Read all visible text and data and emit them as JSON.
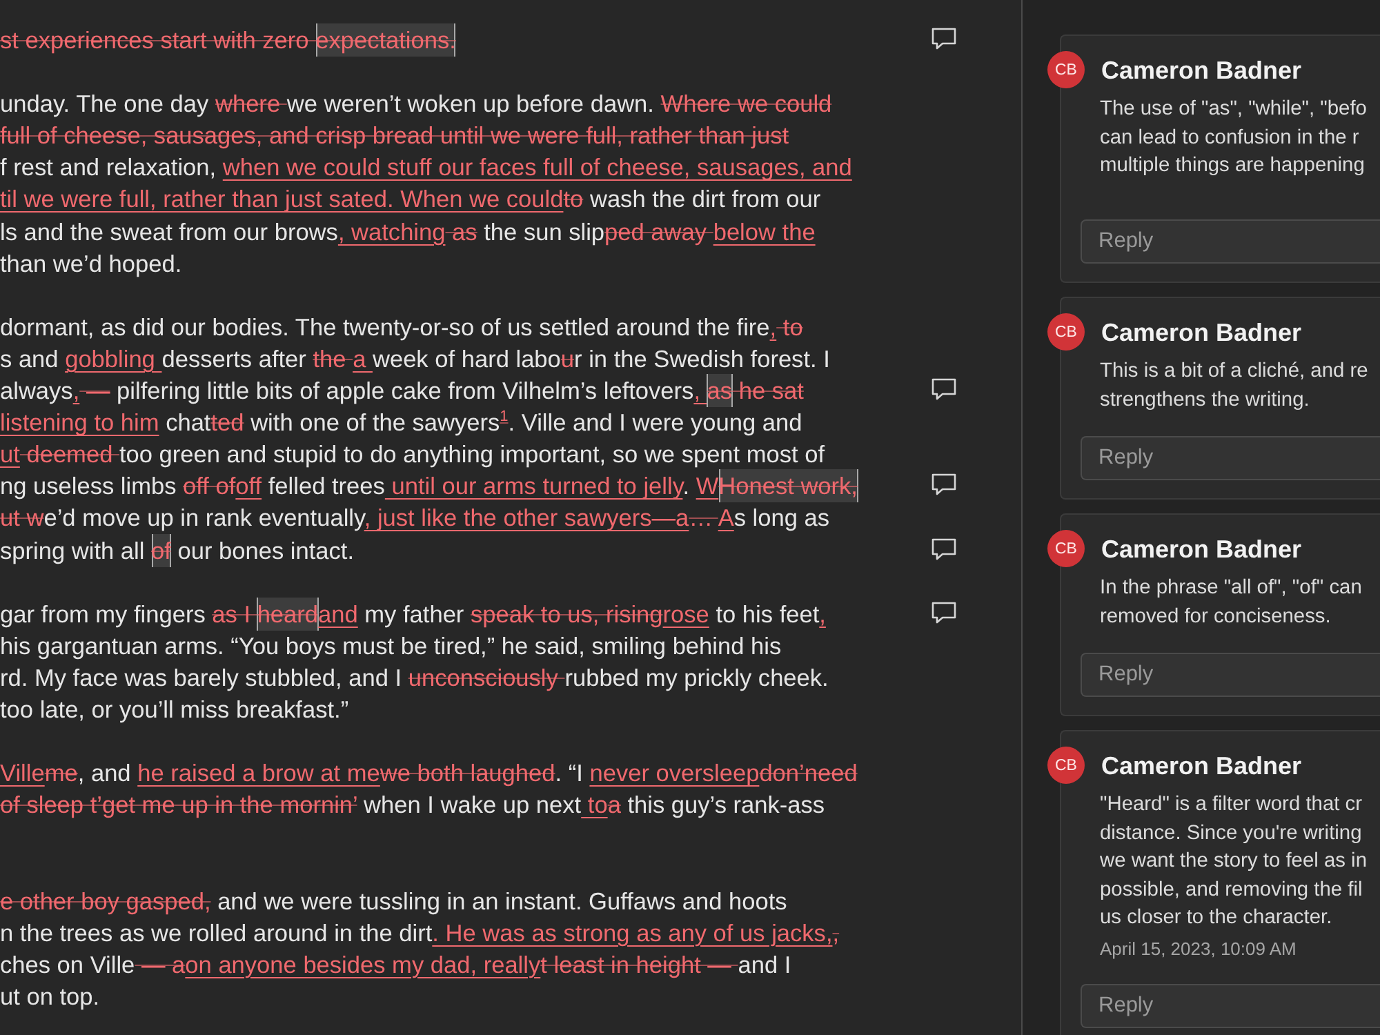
{
  "document": {
    "lines": [
      {
        "kind": "text",
        "comment": true,
        "parts": [
          {
            "kind": "deleted",
            "text": "st experiences start with zero "
          },
          {
            "kind": "anchored",
            "text": "expectations."
          }
        ]
      },
      {
        "kind": "blank",
        "comment": false
      },
      {
        "kind": "text",
        "comment": false,
        "parts": [
          {
            "kind": "text",
            "text": "unday. The one day "
          },
          {
            "kind": "deleted",
            "text": "where "
          },
          {
            "kind": "text",
            "text": "we weren’t woken up before dawn. "
          },
          {
            "kind": "deleted",
            "text": "Where we could"
          }
        ]
      },
      {
        "kind": "text",
        "comment": false,
        "parts": [
          {
            "kind": "deleted",
            "text": "full of cheese, sausages, and crisp bread until we were full, rather than just"
          }
        ]
      },
      {
        "kind": "text",
        "comment": false,
        "parts": [
          {
            "kind": "text",
            "text": "f rest and relaxation, "
          },
          {
            "kind": "inserted",
            "text": "when we could stuff our faces full of cheese, sausages, and"
          }
        ]
      },
      {
        "kind": "text",
        "comment": false,
        "parts": [
          {
            "kind": "inserted",
            "text": "til we were full, rather than just sated. When we could"
          },
          {
            "kind": "deleted",
            "text": "to"
          },
          {
            "kind": "text",
            "text": " wash the dirt from our"
          }
        ]
      },
      {
        "kind": "text",
        "comment": false,
        "parts": [
          {
            "kind": "text",
            "text": "ls and the sweat from our brows"
          },
          {
            "kind": "inserted",
            "text": ", watching"
          },
          {
            "kind": "deleted",
            "text": " as"
          },
          {
            "kind": "text",
            "text": " the sun slip"
          },
          {
            "kind": "deleted",
            "text": "ped away "
          },
          {
            "kind": "inserted",
            "text": "below the"
          }
        ]
      },
      {
        "kind": "text",
        "comment": false,
        "parts": [
          {
            "kind": "text",
            "text": "than we’d hoped."
          }
        ]
      },
      {
        "kind": "blank",
        "comment": false
      },
      {
        "kind": "text",
        "comment": false,
        "parts": [
          {
            "kind": "text",
            "text": "dormant, as did our bodies. The twenty-or-so of us settled around the fire"
          },
          {
            "kind": "inserted",
            "text": ","
          },
          {
            "kind": "deleted",
            "text": " to"
          }
        ]
      },
      {
        "kind": "text",
        "comment": false,
        "parts": [
          {
            "kind": "text",
            "text": "s and "
          },
          {
            "kind": "inserted",
            "text": "gobbling "
          },
          {
            "kind": "text",
            "text": "desserts after "
          },
          {
            "kind": "deleted",
            "text": "the "
          },
          {
            "kind": "inserted",
            "text": "a "
          },
          {
            "kind": "text",
            "text": "week of hard labo"
          },
          {
            "kind": "deleted",
            "text": "u"
          },
          {
            "kind": "text",
            "text": "r in the Swedish forest. I"
          }
        ]
      },
      {
        "kind": "text",
        "comment": true,
        "parts": [
          {
            "kind": "text",
            "text": "always"
          },
          {
            "kind": "inserted",
            "text": ","
          },
          {
            "kind": "deleted",
            "text": " —"
          },
          {
            "kind": "text",
            "text": " pilfering little bits of apple cake from Vilhelm’s leftovers"
          },
          {
            "kind": "inserted",
            "text": ", "
          },
          {
            "kind": "anchored",
            "text": "as"
          },
          {
            "kind": "deleted",
            "text": " he sat"
          }
        ]
      },
      {
        "kind": "text",
        "comment": false,
        "parts": [
          {
            "kind": "inserted",
            "text": "listening to him"
          },
          {
            "kind": "text",
            "text": " chat"
          },
          {
            "kind": "deleted",
            "text": "ted"
          },
          {
            "kind": "text",
            "text": " with one of the sawyers"
          },
          {
            "kind": "deleted",
            "text": "$^{1}$"
          },
          {
            "kind": "text",
            "text": ". Ville and I were young and"
          }
        ]
      },
      {
        "kind": "text",
        "comment": false,
        "parts": [
          {
            "kind": "inserted",
            "text": "ut"
          },
          {
            "kind": "deleted",
            "text": " deemed "
          },
          {
            "kind": "text",
            "text": "too green and stupid to do anything important, so we spent most of"
          }
        ]
      },
      {
        "kind": "text",
        "comment": true,
        "parts": [
          {
            "kind": "text",
            "text": "ng useless limbs "
          },
          {
            "kind": "deleted",
            "text": "off of"
          },
          {
            "kind": "inserted",
            "text": "off"
          },
          {
            "kind": "text",
            "text": " felled trees"
          },
          {
            "kind": "inserted",
            "text": " until our arms turned to jelly"
          },
          {
            "kind": "text",
            "text": ". "
          },
          {
            "kind": "inserted",
            "text": "W"
          },
          {
            "kind": "anchored",
            "text": "Honest work,"
          }
        ]
      },
      {
        "kind": "text",
        "comment": false,
        "parts": [
          {
            "kind": "deleted",
            "text": "ut w"
          },
          {
            "kind": "text",
            "text": "e’d move up in rank eventually"
          },
          {
            "kind": "inserted",
            "text": ", just like the other sawyers—a"
          },
          {
            "kind": "deleted",
            "text": "… "
          },
          {
            "kind": "inserted",
            "text": "A"
          },
          {
            "kind": "text",
            "text": "s long as"
          }
        ]
      },
      {
        "kind": "text",
        "comment": true,
        "parts": [
          {
            "kind": "text",
            "text": "spring with all "
          },
          {
            "kind": "anchored",
            "text": "of"
          },
          {
            "kind": "text",
            "text": " our bones intact."
          }
        ]
      },
      {
        "kind": "blank",
        "comment": false
      },
      {
        "kind": "text",
        "comment": true,
        "parts": [
          {
            "kind": "text",
            "text": "gar from my fingers "
          },
          {
            "kind": "deleted",
            "text": "as I "
          },
          {
            "kind": "anchored",
            "text": "heard"
          },
          {
            "kind": "inserted",
            "text": "and"
          },
          {
            "kind": "text",
            "text": " my father "
          },
          {
            "kind": "deleted",
            "text": "speak to us, rising"
          },
          {
            "kind": "inserted",
            "text": "rose"
          },
          {
            "kind": "text",
            "text": " to his feet"
          },
          {
            "kind": "inserted",
            "text": ","
          }
        ]
      },
      {
        "kind": "text",
        "comment": false,
        "parts": [
          {
            "kind": "text",
            "text": "his gargantuan arms. “You boys must be tired,” he said, smiling behind his"
          }
        ]
      },
      {
        "kind": "text",
        "comment": false,
        "parts": [
          {
            "kind": "text",
            "text": "rd. My face was barely stubbled, and I "
          },
          {
            "kind": "deleted",
            "text": "unconsciously "
          },
          {
            "kind": "text",
            "text": "rubbed my prickly cheek."
          }
        ]
      },
      {
        "kind": "text",
        "comment": false,
        "parts": [
          {
            "kind": "text",
            "text": "too late, or you’ll miss breakfast.”"
          }
        ]
      },
      {
        "kind": "blank",
        "comment": false
      },
      {
        "kind": "text",
        "comment": false,
        "parts": [
          {
            "kind": "inserted",
            "text": "Ville"
          },
          {
            "kind": "deleted",
            "text": "me"
          },
          {
            "kind": "text",
            "text": ", and "
          },
          {
            "kind": "inserted",
            "text": "he raised a brow at me"
          },
          {
            "kind": "deleted",
            "text": "we both laughed"
          },
          {
            "kind": "text",
            "text": ". “I "
          },
          {
            "kind": "inserted",
            "text": "never oversleep"
          },
          {
            "kind": "deleted",
            "text": "don’need"
          }
        ]
      },
      {
        "kind": "text",
        "comment": false,
        "parts": [
          {
            "kind": "deleted",
            "text": "of sleep t’get me up in the mornin’"
          },
          {
            "kind": "text",
            "text": " when I wake up next"
          },
          {
            "kind": "inserted",
            "text": " to"
          },
          {
            "kind": "deleted",
            "text": "a"
          },
          {
            "kind": "text",
            "text": " this guy’s rank-ass"
          }
        ]
      },
      {
        "kind": "blank",
        "comment": false
      },
      {
        "kind": "blank",
        "comment": false
      },
      {
        "kind": "text",
        "comment": false,
        "parts": [
          {
            "kind": "deleted",
            "text": "e other boy gasped,"
          },
          {
            "kind": "text",
            "text": " and we were tussling in an instant. Guffaws and hoots"
          }
        ]
      },
      {
        "kind": "text",
        "comment": false,
        "parts": [
          {
            "kind": "text",
            "text": "n the trees as we rolled around in the dirt"
          },
          {
            "kind": "inserted",
            "text": ". He was as strong as any of us jacks,"
          },
          {
            "kind": "deleted",
            "text": ","
          }
        ]
      },
      {
        "kind": "text",
        "comment": false,
        "parts": [
          {
            "kind": "text",
            "text": "ches on Ville"
          },
          {
            "kind": "deleted",
            "text": " — a"
          },
          {
            "kind": "inserted",
            "text": "on anyone besides my dad, really"
          },
          {
            "kind": "deleted",
            "text": "t least in height — "
          },
          {
            "kind": "text",
            "text": "and I"
          }
        ]
      },
      {
        "kind": "text",
        "comment": false,
        "parts": [
          {
            "kind": "text",
            "text": "ut on top."
          }
        ]
      }
    ]
  },
  "comments": [
    {
      "avatar": "CB",
      "author": "Cameron Badner",
      "collapsed": true,
      "text_lines": [
        "The use of \"as\", \"while\", \"befo",
        "can lead to confusion in the r",
        "multiple things are happening"
      ],
      "reply_placeholder": "Reply"
    },
    {
      "avatar": "CB",
      "author": "Cameron Badner",
      "collapsed": false,
      "text_lines": [
        "This is a bit of a cliché, and re",
        "strengthens the writing."
      ],
      "reply_placeholder": "Reply"
    },
    {
      "avatar": "CB",
      "author": "Cameron Badner",
      "collapsed": false,
      "text_lines": [
        "In the phrase \"all of\", \"of\" can",
        "removed for conciseness."
      ],
      "reply_placeholder": "Reply"
    },
    {
      "avatar": "CB",
      "author": "Cameron Badner",
      "collapsed": false,
      "text_lines": [
        "\"Heard\" is a filter word that cr",
        "distance. Since you're writing",
        "we want the story to feel as in",
        "possible, and removing the fil",
        "us closer to the character."
      ],
      "date": "April 15, 2023, 10:09 AM",
      "reply_placeholder": "Reply"
    }
  ]
}
